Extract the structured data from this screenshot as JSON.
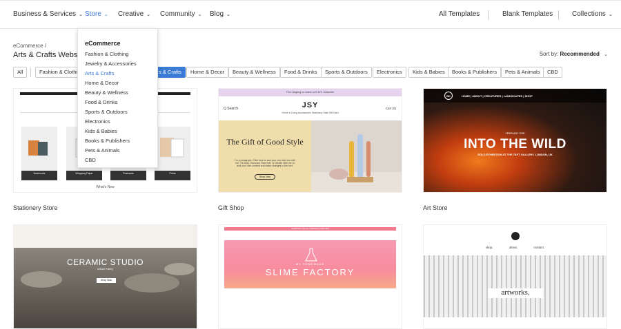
{
  "topnav": {
    "left": [
      {
        "label": "Business & Services"
      },
      {
        "label": "Store"
      },
      {
        "label": "Creative"
      },
      {
        "label": "Community"
      },
      {
        "label": "Blog"
      }
    ],
    "right": [
      {
        "label": "All Templates"
      },
      {
        "label": "Blank Templates"
      },
      {
        "label": "Collections"
      }
    ],
    "chevron": "⌄"
  },
  "dropdown": {
    "heading": "eCommerce",
    "items": [
      "Fashion & Clothing",
      "Jewelry & Accessories",
      "Arts & Crafts",
      "Home & Decor",
      "Beauty & Wellness",
      "Food & Drinks",
      "Sports & Outdoors",
      "Electronics",
      "Kids & Babies",
      "Books & Publishers",
      "Pets & Animals",
      "CBD"
    ],
    "active_index": 2
  },
  "header": {
    "breadcrumb": "eCommerce /",
    "title": "Arts & Crafts Websit",
    "sort_label": "Sort by:",
    "sort_value": "Recommended"
  },
  "chips": [
    {
      "label": "All"
    },
    {
      "label": "Fashion & Clothin"
    },
    {
      "label": "s & Crafts",
      "selected": true
    },
    {
      "label": "Home & Decor"
    },
    {
      "label": "Beauty & Wellness"
    },
    {
      "label": "Food & Drinks"
    },
    {
      "label": "Sports & Outdoors"
    },
    {
      "label": "Electronics"
    },
    {
      "label": "Kids & Babies"
    },
    {
      "label": "Books & Publishers"
    },
    {
      "label": "Pets & Animals"
    },
    {
      "label": "CBD"
    }
  ],
  "cards": {
    "stationery": {
      "name": "Stationery Store",
      "footer": "What's New",
      "products": [
        "Notebooks",
        "Wrapping Paper",
        "Postcards",
        "Prints"
      ]
    },
    "gift": {
      "name": "Gift Shop",
      "banner": "Free shipping on orders over $75. Subscribe",
      "logo": "JSY",
      "search": "Q Search",
      "links": "Home & Living   Accessories   Stationery   Sale   Gift Card",
      "cart": "Cart (0)",
      "hero_title": "The Gift of Good Style",
      "hero_text": "I'm a paragraph. Click here to add your own text and edit me. It's easy. Just click \"Edit Text\" or double click me to add your own content and make changes to the font.",
      "hero_button": "Shop Now"
    },
    "art": {
      "name": "Art Store",
      "logo": "BK",
      "nav": "HOME  |  ABOUT  |  CREATURES  |  LANDSCAPES  |  SHOP",
      "date": "FEBRUARY 2035",
      "title": "INTO THE WILD",
      "subtitle": "SOLO EXHIBITION AT THE TAFT GALLERY, LONDON, UK"
    },
    "ceramic": {
      "title": "CERAMIC STUDIO",
      "subtitle": "Artisan Pottery",
      "button": "Shop Now"
    },
    "slime": {
      "banner": "SHIPPING ON ALL ORDERS OVER $50",
      "small": "MY HOMEMADE",
      "title": "SLIME FACTORY"
    },
    "artworks": {
      "nav": "shop. about. contact.",
      "word": "artworks."
    }
  }
}
